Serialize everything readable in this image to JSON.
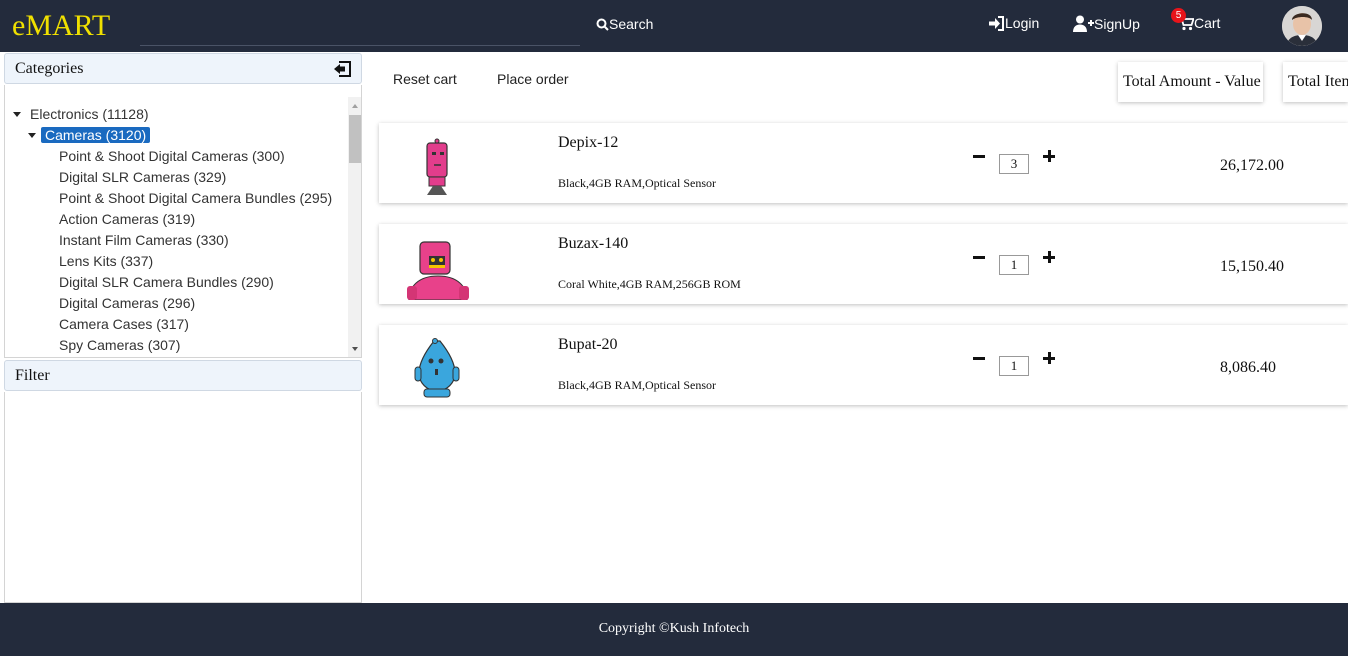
{
  "header": {
    "logo": "eMART",
    "search_label": "Search",
    "nav": {
      "login": "Login",
      "signup": "SignUp",
      "cart": "Cart",
      "cart_count": "5"
    },
    "colors": {
      "background": "#232b3c",
      "logo": "#f0e000",
      "badge": "#e8141a"
    }
  },
  "sidebar": {
    "categories_title": "Categories",
    "filter_title": "Filter",
    "tree": {
      "root": "Electronics (11128)",
      "selected": "Cameras (3120)",
      "children": [
        "Point & Shoot Digital Cameras (300)",
        "Digital SLR Cameras (329)",
        "Point & Shoot Digital Camera Bundles (295)",
        "Action Cameras (319)",
        "Instant Film Cameras (330)",
        "Lens Kits (337)",
        "Digital SLR Camera Bundles (290)",
        "Digital Cameras (296)",
        "Camera Cases (317)",
        "Spy Cameras (307)"
      ]
    },
    "selection_color": "#1a6ac0"
  },
  "main": {
    "reset_label": "Reset cart",
    "place_order_label": "Place order",
    "total_amount_label": "Total Amount - Value",
    "total_items_label": "Total Items",
    "items": [
      {
        "name": "Depix-12",
        "desc": "Black,4GB RAM,Optical Sensor",
        "qty": "3",
        "price": "26,172.00",
        "icon": "pink-robot-image"
      },
      {
        "name": "Buzax-140",
        "desc": "Coral White,4GB RAM,256GB ROM",
        "qty": "1",
        "price": "15,150.40",
        "icon": "pink-robot-image"
      },
      {
        "name": "Bupat-20",
        "desc": "Black,4GB RAM,Optical Sensor",
        "qty": "1",
        "price": "8,086.40",
        "icon": "blue-robot-image"
      }
    ]
  },
  "footer": {
    "copyright": "Copyright ©Kush Infotech"
  }
}
